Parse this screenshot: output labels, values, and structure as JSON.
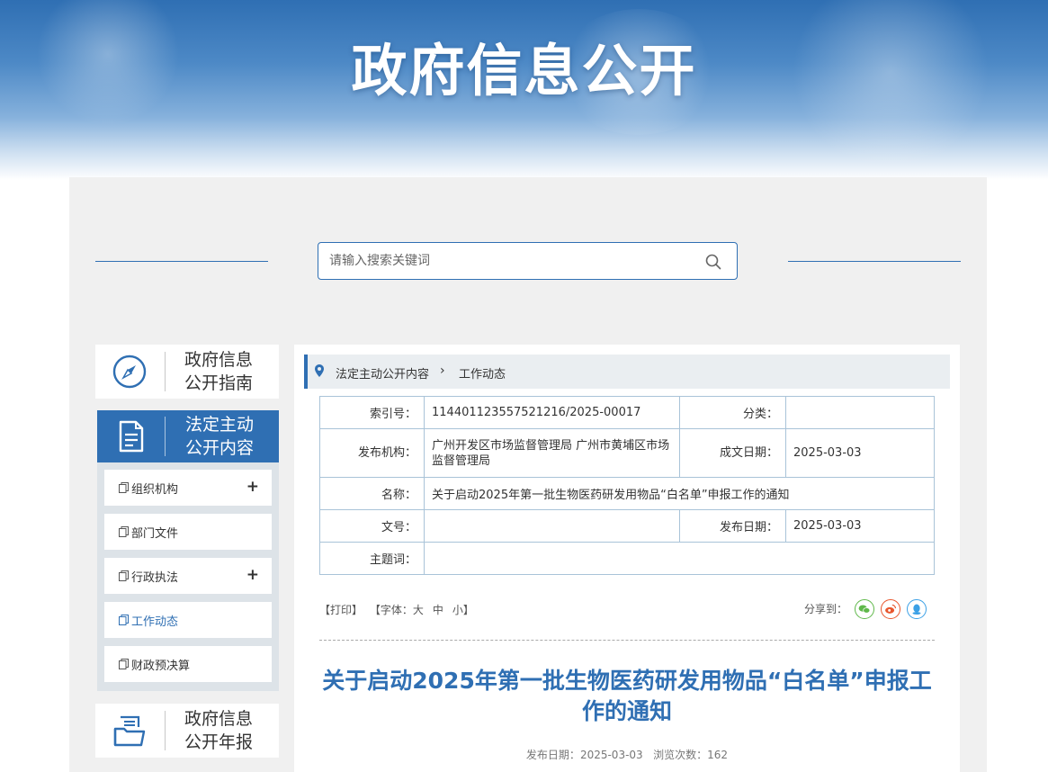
{
  "banner": {
    "title": "政府信息公开"
  },
  "search": {
    "placeholder": "请输入搜索关键词"
  },
  "sidebar": {
    "guide": {
      "line1": "政府信息",
      "line2": "公开指南"
    },
    "active": {
      "line1": "法定主动",
      "line2": "公开内容"
    },
    "items": [
      {
        "label": "组织机构",
        "expandable": "+"
      },
      {
        "label": "部门文件"
      },
      {
        "label": "行政执法",
        "expandable": "+"
      },
      {
        "label": "工作动态"
      },
      {
        "label": "财政预决算"
      }
    ],
    "report": {
      "line1": "政府信息",
      "line2": "公开年报"
    }
  },
  "breadcrumb": {
    "parent": "法定主动公开内容",
    "separator": "›",
    "current": "工作动态"
  },
  "meta": {
    "index_label": "索引号：",
    "index_value": "114401123557521216/2025-00017",
    "category_label": "分类：",
    "category_value": "",
    "publisher_label": "发布机构：",
    "publisher_value": "广州开发区市场监督管理局 广州市黄埔区市场监督管理局",
    "created_label": "成文日期：",
    "created_value": "2025-03-03",
    "name_label": "名称：",
    "name_value": "关于启动2025年第一批生物医药研发用物品“白名单”申报工作的通知",
    "docno_label": "文号：",
    "docno_value": "",
    "published_label": "发布日期：",
    "published_value": "2025-03-03",
    "subject_label": "主题词：",
    "subject_value": ""
  },
  "tools": {
    "print": "【打印】",
    "font_prefix": "【字体：",
    "font_large": "大",
    "font_medium": "中",
    "font_small": "小",
    "font_suffix": "】",
    "share_label": "分享到："
  },
  "article": {
    "title": "关于启动2025年第一批生物医药研发用物品“白名单”申报工作的通知",
    "publish_label": "发布日期：",
    "publish_date": "2025-03-03",
    "views_label": "浏览次数：",
    "views": "162"
  },
  "colors": {
    "accent": "#2f6fb3",
    "wechat": "#5fb84a",
    "weibo": "#e8562d",
    "qq": "#3aa0e6"
  },
  "icons": {
    "compass": "compass-icon",
    "document": "document-icon",
    "report": "report-icon",
    "search": "search-icon",
    "pin": "location-pin-icon",
    "wechat": "wechat-icon",
    "weibo": "weibo-icon",
    "qq": "qq-icon"
  }
}
